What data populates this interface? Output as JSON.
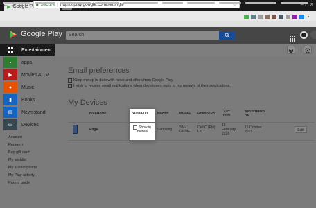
{
  "browser": {
    "tab_title": "Google Play",
    "secure_label": "Secure",
    "url": "https://play.google.com/settings/"
  },
  "header": {
    "brand": "Google Play",
    "search_placeholder": "Search"
  },
  "sidebar": {
    "active": "Entertainment",
    "categories": [
      {
        "label": "apps",
        "color": "#2e7d32"
      },
      {
        "label": "Movies & TV",
        "color": "#b71c1c"
      },
      {
        "label": "Music",
        "color": "#e65100"
      },
      {
        "label": "Books",
        "color": "#1565c0"
      },
      {
        "label": "Newsstand",
        "color": "#1565c0"
      },
      {
        "label": "Devices",
        "color": "#37474f"
      }
    ],
    "links": [
      "Account",
      "Redeem",
      "Buy gift card",
      "My wishlist",
      "My subscriptions",
      "My Play activity",
      "Parent guide"
    ]
  },
  "email_prefs": {
    "title": "Email preferences",
    "options": [
      "Keep me up to date with news and offers from Google Play.",
      "I wish to receive email notifications when developers reply to my reviews of their applications."
    ]
  },
  "devices": {
    "title": "My Devices",
    "columns": {
      "nickname": "NICKNAME",
      "visibility": "VISIBILITY",
      "maker": "MAKER",
      "model": "MODEL",
      "operator": "OPERATOR",
      "last_used_1": "LAST",
      "last_used_2": "USED",
      "registered_1": "REGISTERED",
      "registered_2": "ON"
    },
    "row": {
      "nickname": "Edge",
      "visibility_1": "Show in",
      "visibility_2": "menus",
      "maker": "Samsung",
      "model_1": "SM-",
      "model_2": "G928F",
      "operator_1": "Cell C (Pty)",
      "operator_2": "Ltd.",
      "last_used_1": "16",
      "last_used_2": "February",
      "last_used_3": "2018",
      "registered_1": "16 October",
      "registered_2": "2015",
      "edit": "Edit"
    }
  }
}
